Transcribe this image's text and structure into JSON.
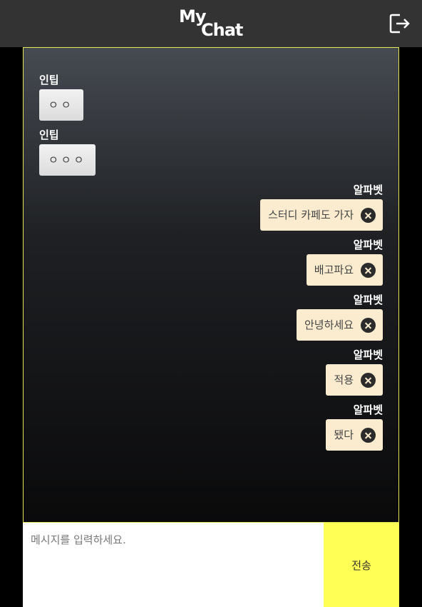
{
  "header": {
    "logo_line1": "My",
    "logo_line2": "Chat",
    "logout_icon": "logout-icon"
  },
  "messages": [
    {
      "side": "left",
      "sender": "인팁",
      "text": "ㅇㅇ"
    },
    {
      "side": "left",
      "sender": "인팁",
      "text": "ㅇㅇㅇ"
    },
    {
      "side": "right",
      "sender": "알파벳",
      "text": "스터디 카페도 가자"
    },
    {
      "side": "right",
      "sender": "알파벳",
      "text": "배고파요"
    },
    {
      "side": "right",
      "sender": "알파벳",
      "text": "안녕하세요"
    },
    {
      "side": "right",
      "sender": "알파벳",
      "text": "적용"
    },
    {
      "side": "right",
      "sender": "알파벳",
      "text": "됐다"
    }
  ],
  "composer": {
    "placeholder": "메시지를 입력하세요.",
    "value": "",
    "send_label": "전송"
  },
  "colors": {
    "header_bg": "#333333",
    "chat_border": "#e6e65a",
    "my_bubble": "#fbeccf",
    "send_button": "#ffff55"
  }
}
